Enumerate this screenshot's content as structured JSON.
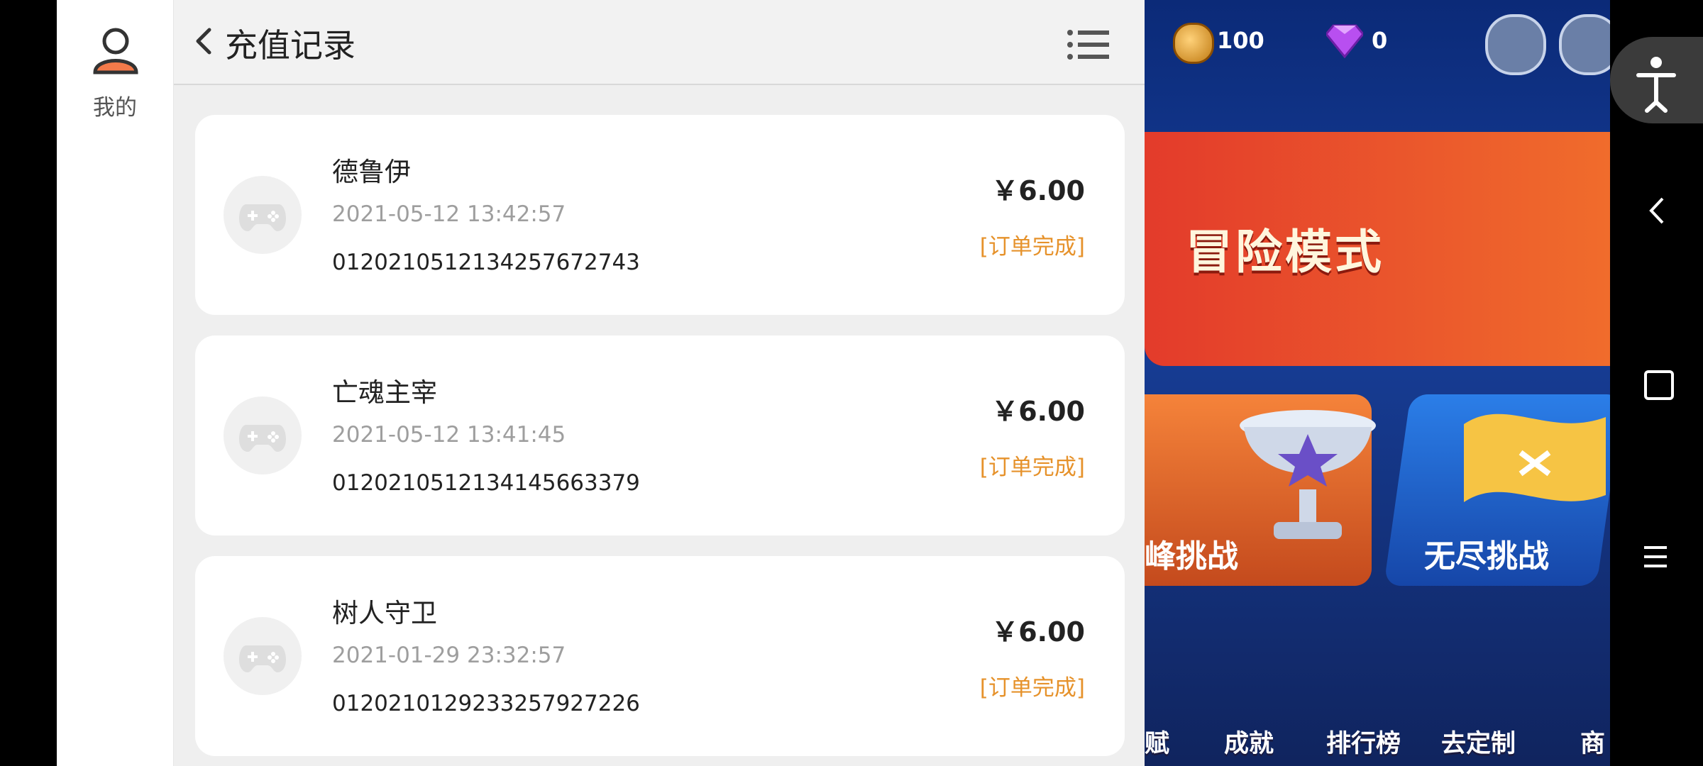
{
  "sidebar": {
    "me_label": "我的"
  },
  "header": {
    "title": "充值记录"
  },
  "records": [
    {
      "name": "德鲁伊",
      "time": "2021-05-12 13:42:57",
      "order": "0120210512134257672743",
      "price": "￥6.00",
      "status": "[订单完成]"
    },
    {
      "name": "亡魂主宰",
      "time": "2021-05-12 13:41:45",
      "order": "0120210512134145663379",
      "price": "￥6.00",
      "status": "[订单完成]"
    },
    {
      "name": "树人守卫",
      "time": "2021-01-29 23:32:57",
      "order": "0120210129233257927226",
      "price": "￥6.00",
      "status": "[订单完成]"
    }
  ],
  "game": {
    "coins": "100",
    "gems": "0",
    "adventure_mode": "冒险模式",
    "peak_challenge": "峰挑战",
    "endless_challenge": "无尽挑战",
    "nav": [
      "赋",
      "成就",
      "排行榜",
      "去定制",
      "商"
    ]
  },
  "colors": {
    "accent_orange": "#e6922b",
    "panel_bg": "#efefef"
  },
  "icons": {
    "avatar": "user-icon",
    "back": "chevron-left-icon",
    "menu": "list-icon",
    "game": "gamepad-icon",
    "accessibility": "accessibility-icon"
  }
}
